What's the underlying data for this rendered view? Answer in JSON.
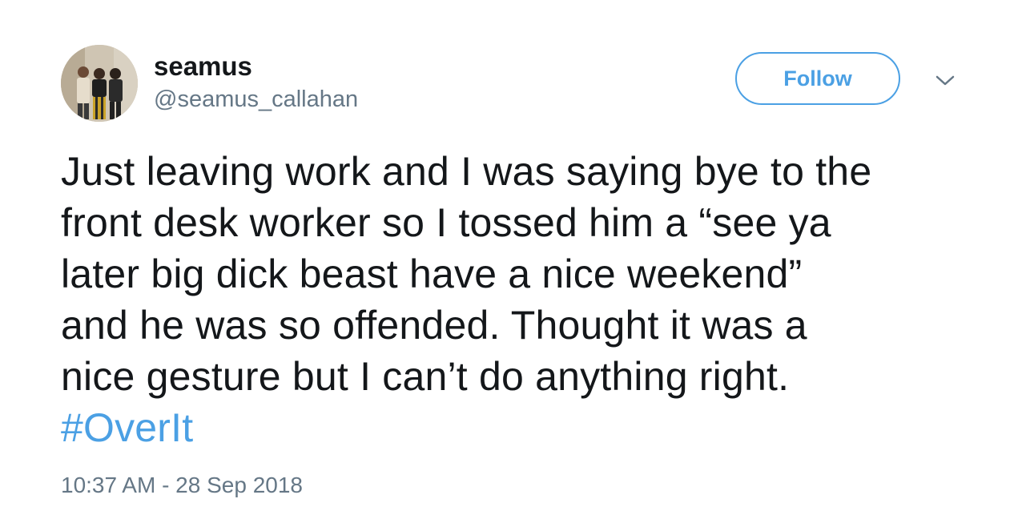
{
  "user": {
    "display_name": "seamus",
    "handle": "@seamus_callahan",
    "avatar_icon": "profile-photo"
  },
  "follow_button": {
    "label": "Follow"
  },
  "menu": {
    "icon": "chevron-down-icon"
  },
  "tweet": {
    "lines": [
      "Just leaving work and I was saying bye to the",
      "front desk worker so I tossed him a “see ya",
      "later big dick beast have a nice weekend”",
      "and he was so offended. Thought it was a",
      "nice gesture but I can’t do anything right."
    ],
    "hashtag": "#OverIt",
    "timestamp": "10:37 AM - 28 Sep 2018"
  },
  "colors": {
    "accent": "#4ba0e4",
    "text": "#14171a",
    "secondary": "#657786"
  }
}
